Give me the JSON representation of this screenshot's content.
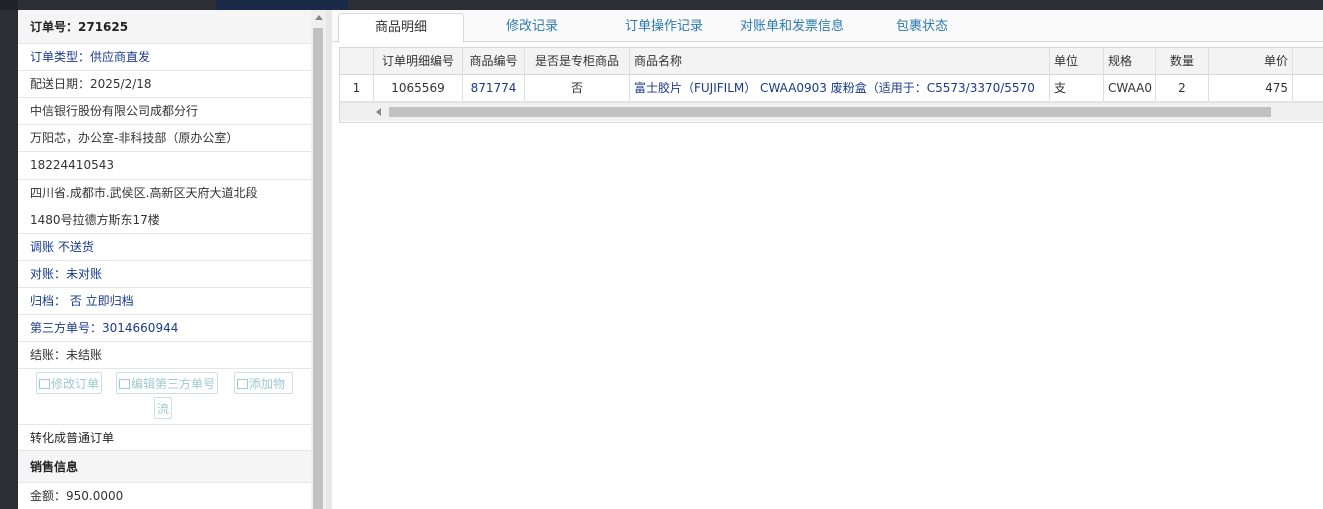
{
  "order": {
    "number_label": "订单号：271625",
    "type_label": "订单类型：供应商直发",
    "delivery_date": "配送日期：2025/2/18",
    "company": "中信银行股份有限公司成都分行",
    "contact": "万阳芯，办公室-非科技部（原办公室）",
    "phone": "18224410543",
    "address_line1": "四川省.成都市.武侯区.高新区天府大道北段",
    "address_line2": "1480号拉德方斯东17楼",
    "adjust": "调账 不送货",
    "reconcile": "对账：未对账",
    "archive_label": "归档：",
    "archive_value": " 否 立即归档",
    "third_party": "第三方单号：3014660944",
    "settlement": "结账：未结账",
    "btn_edit_order": "修改订单",
    "btn_edit_third": "编辑第三方单号",
    "btn_add_logistics_1": "添加物",
    "btn_add_logistics_2": "流",
    "convert": "转化成普通订单",
    "sales_section": "销售信息",
    "amount": "金额：950.0000"
  },
  "tabs": [
    {
      "label": "商品明细",
      "active": true
    },
    {
      "label": "修改记录"
    },
    {
      "label": "订单操作记录"
    },
    {
      "label": "对账单和发票信息"
    },
    {
      "label": "包裹状态"
    }
  ],
  "table": {
    "columns": [
      "",
      "订单明细编号",
      "商品编号",
      "是否是专柜商品",
      "商品名称",
      "单位",
      "规格",
      "数量",
      "单价"
    ],
    "rows": [
      [
        "1",
        "1065569",
        "871774",
        "否",
        "富士胶片（FUJIFILM） CWAA0903 废粉盒（适用于：C5573/3370/5570",
        "支",
        "CWAA0",
        "2",
        "475"
      ]
    ]
  },
  "colors": {
    "link_blue": "#1a3a8c",
    "tab_blue": "#2a7ab0",
    "disabled_button": "#9ccbd2"
  }
}
